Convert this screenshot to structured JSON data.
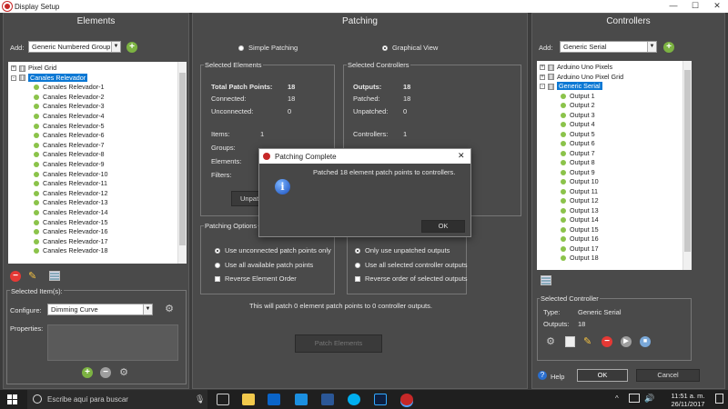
{
  "window": {
    "title": "Display Setup",
    "minimize": "—",
    "maximize": "☐",
    "close": "✕"
  },
  "elements": {
    "title": "Elements",
    "add_label": "Add:",
    "add_value": "Generic Numbered Group",
    "tree": {
      "root1": "Pixel Grid",
      "root2": "Canales Relevador",
      "children": [
        "Canales Relevador-1",
        "Canales Relevador-2",
        "Canales Relevador-3",
        "Canales Relevador-4",
        "Canales Relevador-5",
        "Canales Relevador-6",
        "Canales Relevador-7",
        "Canales Relevador-8",
        "Canales Relevador-9",
        "Canales Relevador-10",
        "Canales Relevador-11",
        "Canales Relevador-12",
        "Canales Relevador-13",
        "Canales Relevador-14",
        "Canales Relevador-15",
        "Canales Relevador-16",
        "Canales Relevador-17",
        "Canales Relevador-18"
      ]
    },
    "selected_items": "Selected Item(s):",
    "configure_label": "Configure:",
    "configure_value": "Dimming Curve",
    "properties_label": "Properties:"
  },
  "patching": {
    "title": "Patching",
    "simple": "Simple Patching",
    "graphical": "Graphical View",
    "sel_elements": {
      "title": "Selected Elements",
      "total_label": "Total Patch Points:",
      "total": "18",
      "connected_label": "Connected:",
      "connected": "18",
      "unconnected_label": "Unconnected:",
      "unconnected": "0",
      "items_label": "Items:",
      "items": "1",
      "groups_label": "Groups:",
      "elements_label": "Elements:",
      "filters_label": "Filters:",
      "unpatch_button": "Unpat"
    },
    "sel_controllers": {
      "title": "Selected Controllers",
      "outputs_label": "Outputs:",
      "outputs": "18",
      "patched_label": "Patched:",
      "patched": "18",
      "unpatched_label": "Unpatched:",
      "unpatched": "0",
      "controllers_label": "Controllers:",
      "controllers": "1"
    },
    "options": {
      "title": "Patching Options",
      "left": [
        "Use unconnected patch points only",
        "Use all available patch points",
        "Reverse Element Order"
      ],
      "right": [
        "Only use unpatched outputs",
        "Use all selected controller outputs",
        "Reverse order of selected outputs"
      ]
    },
    "summary": "This will patch 0 element patch points to 0 controller outputs.",
    "patch_button": "Patch Elements"
  },
  "dialog": {
    "title": "Patching Complete",
    "message": "Patched 18 element patch points to controllers.",
    "ok": "OK",
    "close": "✕"
  },
  "controllers": {
    "title": "Controllers",
    "add_label": "Add:",
    "add_value": "Generic Serial",
    "tree": {
      "root1": "Arduino Uno Pixels",
      "root2": "Arduino Uno Pixel Grid",
      "root3": "Generic Serial",
      "outputs": [
        "Output 1",
        "Output 2",
        "Output 3",
        "Output 4",
        "Output 5",
        "Output 6",
        "Output 7",
        "Output 8",
        "Output 9",
        "Output 10",
        "Output 11",
        "Output 12",
        "Output 13",
        "Output 14",
        "Output 15",
        "Output 16",
        "Output 17",
        "Output 18"
      ]
    },
    "selected_title": "Selected Controller",
    "type_label": "Type:",
    "type_value": "Generic Serial",
    "outputs_label": "Outputs:",
    "outputs_value": "18",
    "help": "Help",
    "ok": "OK",
    "cancel": "Cancel"
  },
  "taskbar": {
    "search_placeholder": "Escribe aquí para buscar",
    "time": "11:51 a. m.",
    "date": "26/11/2017"
  },
  "colors": {
    "accent": "#0b78d4",
    "add_green": "#7cb342",
    "remove_red": "#e53935",
    "panel": "#4a4a4a",
    "background": "#3c3c3c"
  }
}
